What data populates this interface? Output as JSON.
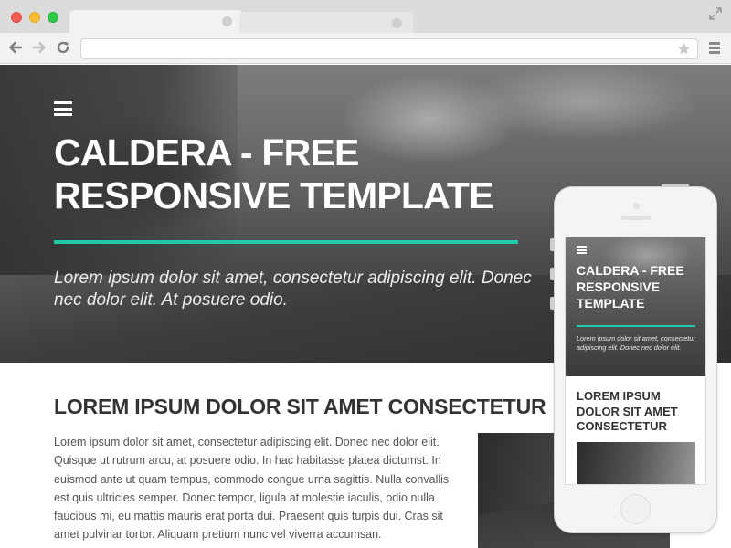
{
  "browser": {
    "tabs": [
      {
        "state": "active"
      },
      {
        "state": "inactive"
      }
    ],
    "address": "",
    "icons": [
      "back-arrow-icon",
      "forward-arrow-icon",
      "reload-icon",
      "star-icon",
      "menu-icon",
      "expand-icon"
    ]
  },
  "hero": {
    "title": "CALDERA - FREE RESPONSIVE TEMPLATE",
    "subtitle": "Lorem ipsum dolor sit amet, consectetur adipiscing elit. Donec nec dolor elit. At posuere odio.",
    "accent_color": "#1fc9a9"
  },
  "content": {
    "heading": "LOREM IPSUM DOLOR SIT AMET CONSECTETUR",
    "body": "Lorem ipsum dolor sit amet, consectetur adipiscing elit. Donec nec dolor elit. Quisque ut rutrum arcu, at posuere odio. In hac habitasse platea dictumst. In euismod ante ut quam tempus, commodo congue urna sagittis. Nulla convallis est quis ultricies semper. Donec tempor, ligula at molestie iaculis, odio nulla faucibus mi, eu mattis mauris erat porta dui. Praesent quis turpis dui. Cras sit amet pulvinar tortor. Aliquam pretium nunc vel viverra accumsan."
  },
  "phone": {
    "title": "CALDERA - FREE RESPONSIVE TEMPLATE",
    "subtitle": "Lorem ipsum dolor sit amet, consectetur adipiscing elit. Donec nec dolor elit.",
    "heading": "LOREM IPSUM DOLOR SIT AMET CONSECTETUR"
  }
}
